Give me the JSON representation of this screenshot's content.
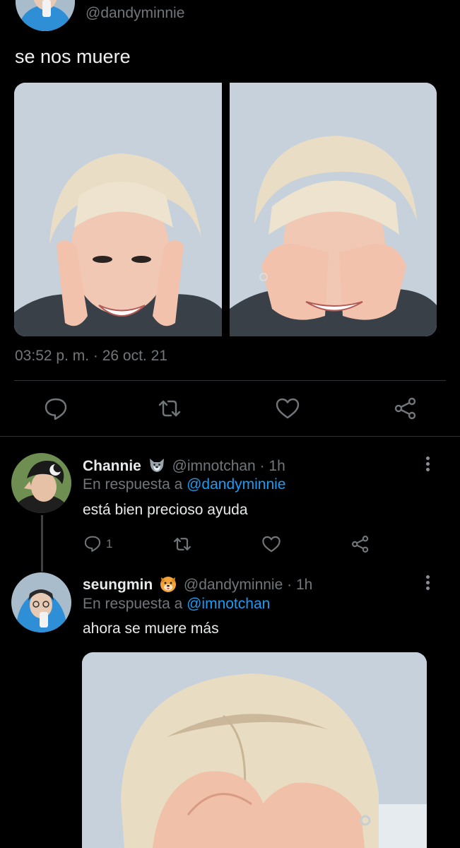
{
  "tweet": {
    "handle": "@dandyminnie",
    "text": "se nos muere",
    "timestamp": "03:52 p. m. · 26 oct. 21",
    "actions": [
      "reply-icon",
      "retweet-icon",
      "like-icon",
      "share-icon"
    ]
  },
  "replies": [
    {
      "name": "Channie",
      "handle": "@imnotchan",
      "sep": " · ",
      "time": "1h",
      "in_reply_prefix": "En respuesta a ",
      "in_reply_to": "@dandyminnie",
      "text": "está bien precioso ayuda",
      "reply_count": "1",
      "emoji": "wolf-icon"
    },
    {
      "name": "seungmin",
      "handle": "@dandyminnie",
      "sep": " · ",
      "time": "1h",
      "in_reply_prefix": "En respuesta a ",
      "in_reply_to": "@imnotchan",
      "text": "ahora se muere más",
      "emoji": "puppy-icon"
    }
  ],
  "colors": {
    "background": "#000000",
    "text": "#e7e9ea",
    "muted": "#71767b",
    "link": "#1d9bf0",
    "divider": "#2f3336"
  }
}
